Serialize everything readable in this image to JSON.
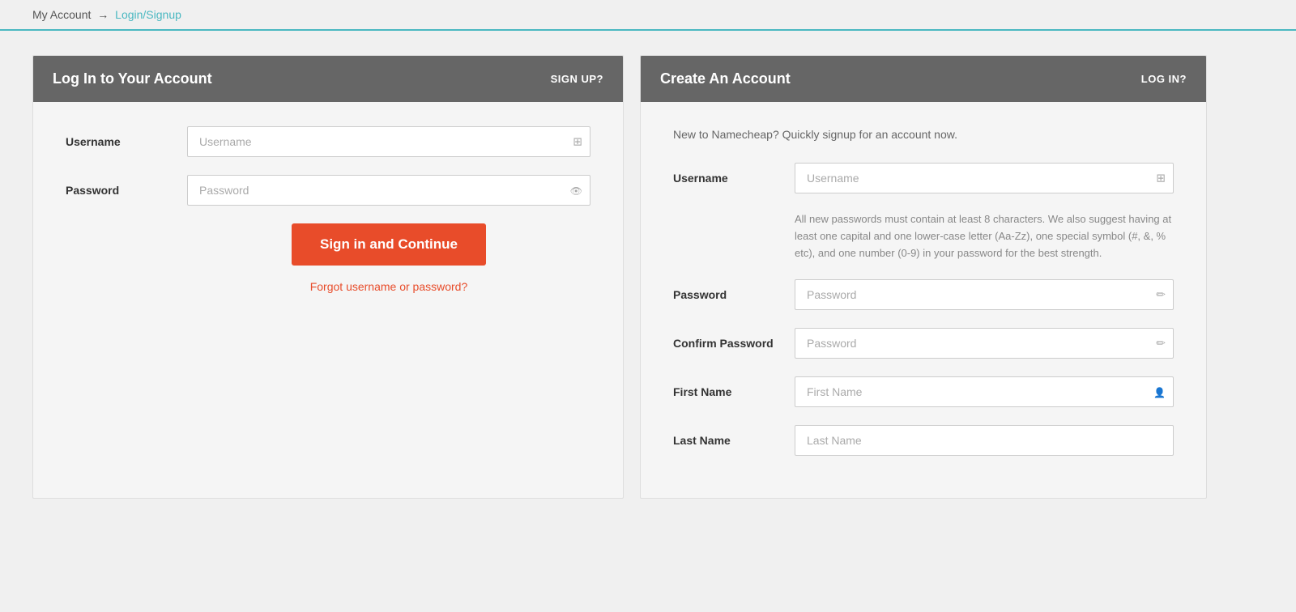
{
  "breadcrumb": {
    "text": "My Account",
    "separator": "→",
    "link_text": "Login/Signup"
  },
  "login_panel": {
    "title": "Log In to Your Account",
    "header_link": "SIGN UP?",
    "username_label": "Username",
    "username_placeholder": "Username",
    "password_label": "Password",
    "password_placeholder": "Password",
    "signin_button": "Sign in and Continue",
    "forgot_link": "Forgot username or password?"
  },
  "signup_panel": {
    "title": "Create An Account",
    "header_link": "LOG IN?",
    "description": "New to Namecheap? Quickly signup for an account now.",
    "username_label": "Username",
    "username_placeholder": "Username",
    "password_hint": "All new passwords must contain at least 8 characters. We also suggest having at least one capital and one lower-case letter (Aa-Zz), one special symbol (#, &, % etc), and one number (0-9) in your password for the best strength.",
    "password_label": "Password",
    "password_placeholder": "Password",
    "confirm_password_label": "Confirm Password",
    "confirm_password_placeholder": "Password",
    "first_name_label": "First Name",
    "first_name_placeholder": "First Name",
    "last_name_label": "Last Name",
    "last_name_placeholder": "Last Name"
  }
}
